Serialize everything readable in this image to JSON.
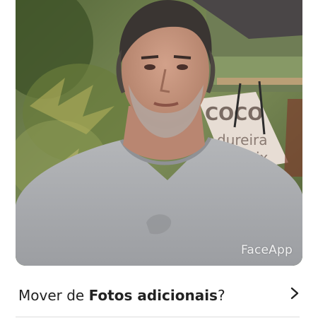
{
  "photo": {
    "watermark": "FaceApp",
    "sign_lines": [
      "COCO",
      "dureira",
      "ix"
    ]
  },
  "move_row": {
    "prefix": "Mover de ",
    "folder": "Fotos adicionais",
    "suffix": "?",
    "chevron_icon": "chevron-right-icon"
  },
  "colors": {
    "text": "#222222",
    "divider": "#dddddd",
    "shirt": "#a9abae"
  }
}
